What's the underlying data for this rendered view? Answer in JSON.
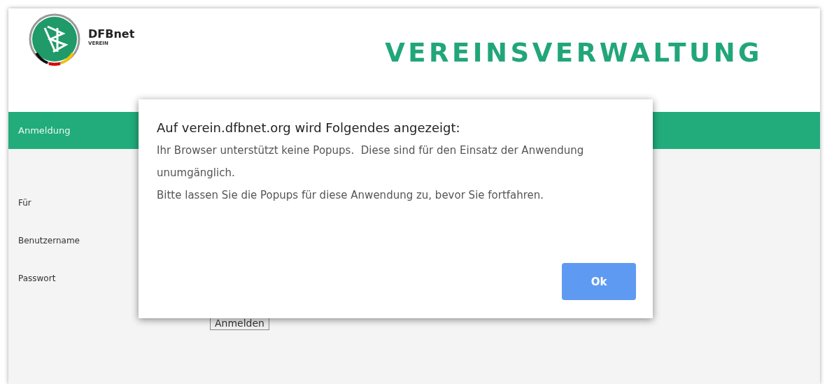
{
  "header": {
    "brand": "DFBnet",
    "sub_brand": "VEREIN",
    "title": "VEREINSVERWALTUNG"
  },
  "nav": {
    "label": "Anmeldung"
  },
  "form": {
    "labels": [
      "Für",
      "Benutzername",
      "Passwort"
    ],
    "submit": "Anmelden"
  },
  "dialog": {
    "title": "Auf verein.dfbnet.org wird Folgendes angezeigt:",
    "paragraphs": [
      "Ihr Browser unterstützt keine Popups.  Diese sind für den Einsatz der Anwendung unumgänglich.",
      "Bitte lassen Sie die Popups für diese Anwendung zu, bevor Sie fortfahren."
    ],
    "button": "Ok"
  }
}
